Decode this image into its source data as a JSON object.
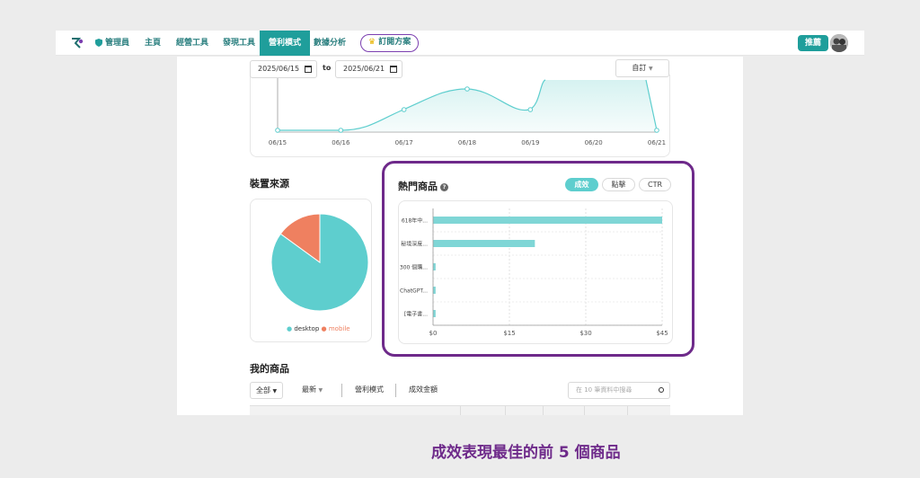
{
  "nav": {
    "admin": "管理員",
    "home": "主頁",
    "ops_tools": "經營工具",
    "discover_tools": "發現工具",
    "affiliate_mode": "營利模式",
    "data_analysis": "數據分析",
    "plan_button": "訂閱方案",
    "promote_button": "推薦"
  },
  "date_range": {
    "start": "2025/06/15",
    "to": "to",
    "end": "2025/06/21",
    "preset": "自訂"
  },
  "line_chart_data": {
    "type": "area",
    "x": [
      "06/15",
      "06/16",
      "06/17",
      "06/18",
      "06/19",
      "06/20",
      "06/21"
    ],
    "colors": {
      "line": "#5ecece",
      "fill": "#d6f2f1"
    }
  },
  "device": {
    "title": "裝置來源",
    "chart_data": {
      "type": "pie",
      "labels": [
        "desktop",
        "mobile"
      ],
      "values": [
        85,
        15
      ],
      "colors": [
        "#5ecece",
        "#ef8060"
      ]
    }
  },
  "hot_products": {
    "title": "熱門商品",
    "tabs": [
      "成效",
      "點擊",
      "CTR"
    ],
    "active_tab": 0,
    "chart_data": {
      "type": "bar",
      "orientation": "horizontal",
      "categories": [
        "618年中...",
        "秘境深度...",
        "300 個購...",
        "ChatGPT...",
        "[電子書..."
      ],
      "values": [
        45,
        20,
        0.5,
        0.5,
        0.5
      ],
      "xlim": [
        0,
        45
      ],
      "xticks": [
        "$0",
        "$15",
        "$30",
        "$45"
      ],
      "color": "#7fd6d6"
    }
  },
  "my_products": {
    "title": "我的商品",
    "filter_all": "全部",
    "sort_latest": "最新",
    "col_mode": "營利模式",
    "col_amount": "成效金額",
    "search_placeholder": "在 10 筆資料中搜尋"
  },
  "caption": "成效表現最佳的前 5 個商品"
}
